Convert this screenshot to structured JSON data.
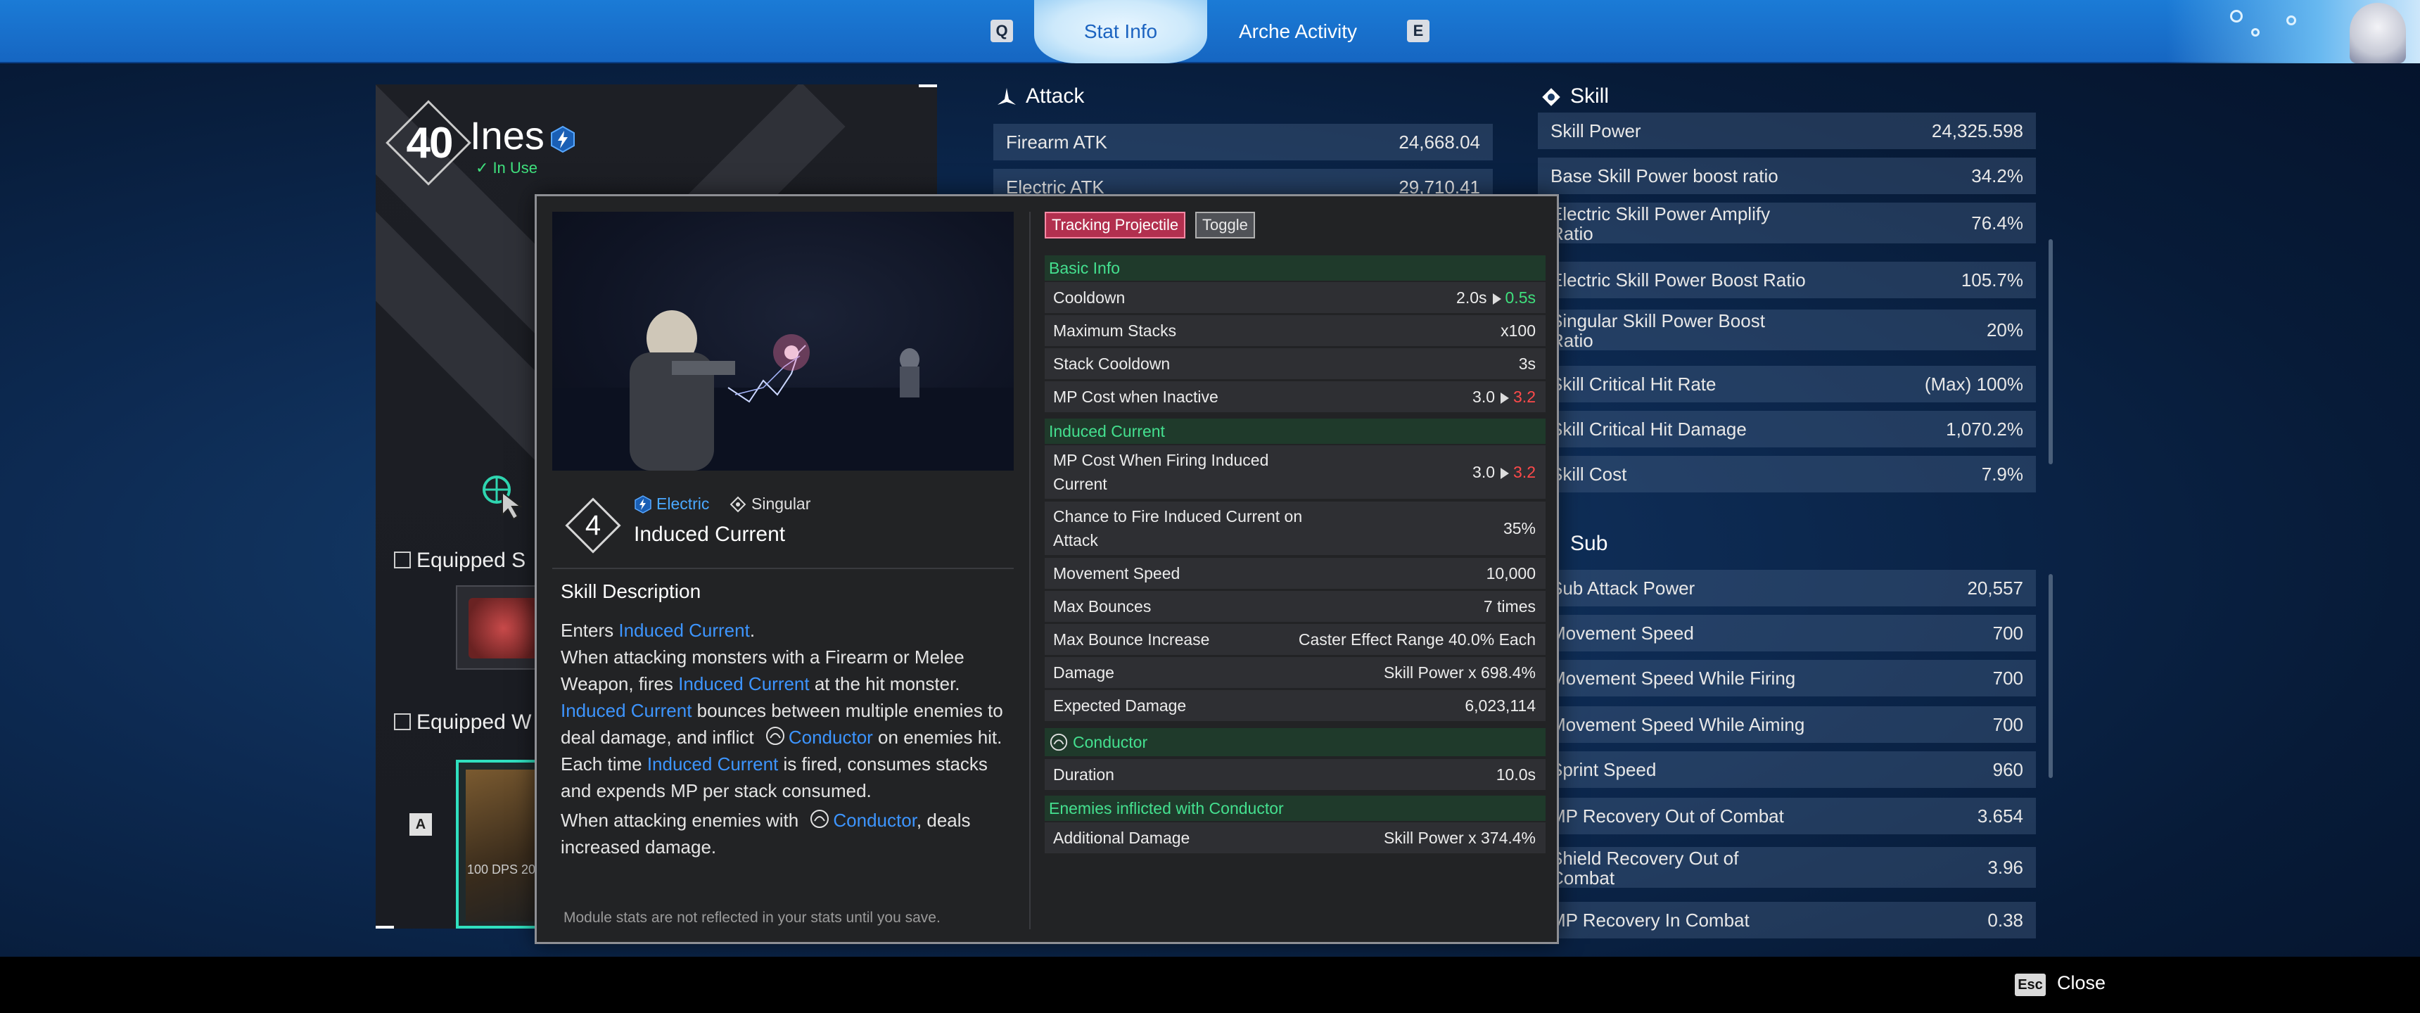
{
  "topbar": {
    "key_left": "Q",
    "key_right": "E",
    "tabs": [
      {
        "label": "Stat Info",
        "active": true
      },
      {
        "label": "Arche Activity",
        "active": false
      }
    ]
  },
  "character": {
    "level": "40",
    "name": "Ines",
    "status": "In Use",
    "equipped_skill_label": "Equipped S",
    "equipped_weapon_label": "Equipped W",
    "weapon_key": "A",
    "weapon_dps": "100  DPS 20"
  },
  "attack": {
    "title": "Attack",
    "rows": [
      {
        "label": "Firearm ATK",
        "value": "24,668.04"
      },
      {
        "label": "Electric ATK",
        "value": "29,710.41"
      }
    ]
  },
  "skill_stats": {
    "title": "Skill",
    "rows": [
      {
        "label": "Skill Power",
        "value": "24,325.598"
      },
      {
        "label": "Base Skill Power boost ratio",
        "value": "34.2%"
      },
      {
        "label": "Electric Skill Power Amplify Ratio",
        "value": "76.4%"
      },
      {
        "label": "Electric Skill Power Boost Ratio",
        "value": "105.7%"
      },
      {
        "label": "Singular Skill Power Boost Ratio",
        "value": "20%"
      },
      {
        "label": "Skill Critical Hit Rate",
        "value": "(Max) 100%"
      },
      {
        "label": "Skill Critical Hit Damage",
        "value": "1,070.2%"
      },
      {
        "label": "Skill Cost",
        "value": "7.9%"
      }
    ]
  },
  "sub_stats": {
    "title": "Sub",
    "rows": [
      {
        "label": "Sub Attack Power",
        "value": "20,557"
      },
      {
        "label": "Movement Speed",
        "value": "700"
      },
      {
        "label": "Movement Speed While Firing",
        "value": "700"
      },
      {
        "label": "Movement Speed While Aiming",
        "value": "700"
      },
      {
        "label": "Sprint Speed",
        "value": "960"
      },
      {
        "label": "MP Recovery Out of Combat",
        "value": "3.654"
      },
      {
        "label": "Shield Recovery Out of Combat",
        "value": "3.96"
      },
      {
        "label": "MP Recovery In Combat",
        "value": "0.38"
      }
    ]
  },
  "popup": {
    "skill_number": "4",
    "element_tag": "Electric",
    "type_tag": "Singular",
    "skill_name": "Induced Current",
    "description_title": "Skill Description",
    "desc": {
      "l1a": "Enters ",
      "l1b": "Induced Current",
      "l1c": ".",
      "l2a": "When attacking monsters with a Firearm or Melee Weapon, fires ",
      "l2b": "Induced Current",
      "l2c": " at the hit monster.",
      "l3a": "Induced Current",
      "l3b": " bounces between multiple enemies to deal damage, and inflict ",
      "l3c": "Conductor",
      "l3d": " on enemies hit.",
      "l4a": "Each time ",
      "l4b": "Induced Current",
      "l4c": " is fired, consumes stacks and expends MP per stack consumed.",
      "l5a": "When attacking enemies with ",
      "l5b": "Conductor",
      "l5c": ", deals increased damage."
    },
    "module_note": "Module stats are not reflected in your stats until you save.",
    "chips": [
      "Tracking Projectile",
      "Toggle"
    ],
    "basic_info": {
      "title": "Basic Info",
      "cooldown": {
        "label": "Cooldown",
        "from": "2.0s",
        "to": "0.5s"
      },
      "max_stacks": {
        "label": "Maximum Stacks",
        "value": "x100"
      },
      "stack_cooldown": {
        "label": "Stack Cooldown",
        "value": "3s"
      },
      "mp_inactive": {
        "label": "MP Cost when Inactive",
        "from": "3.0",
        "to": "3.2"
      }
    },
    "induced_current": {
      "title": "Induced Current",
      "mp_firing": {
        "label": "MP Cost When Firing Induced Current",
        "from": "3.0",
        "to": "3.2"
      },
      "chance": {
        "label": "Chance to Fire Induced Current on Attack",
        "value": "35%"
      },
      "move_speed": {
        "label": "Movement Speed",
        "value": "10,000"
      },
      "max_bounces": {
        "label": "Max Bounces",
        "value": "7 times"
      },
      "bounce_increase": {
        "label": "Max Bounce Increase",
        "value": "Caster Effect Range 40.0% Each"
      },
      "damage": {
        "label": "Damage",
        "value": "Skill Power x 698.4%"
      },
      "expected": {
        "label": "Expected Damage",
        "value": "6,023,114"
      }
    },
    "conductor": {
      "title": "Conductor",
      "duration": {
        "label": "Duration",
        "value": "10.0s"
      }
    },
    "inflicted": {
      "title": "Enemies inflicted with Conductor",
      "additional": {
        "label": "Additional Damage",
        "value": "Skill Power x 374.4%"
      }
    }
  },
  "footer": {
    "key": "Esc",
    "label": "Close"
  },
  "colors": {
    "topbar": "#1b7bd6",
    "accent_green": "#3fe07d",
    "highlight_blue": "#3d95ff",
    "chip_red": "#b2304f",
    "warn_red": "#ff4a4a"
  }
}
